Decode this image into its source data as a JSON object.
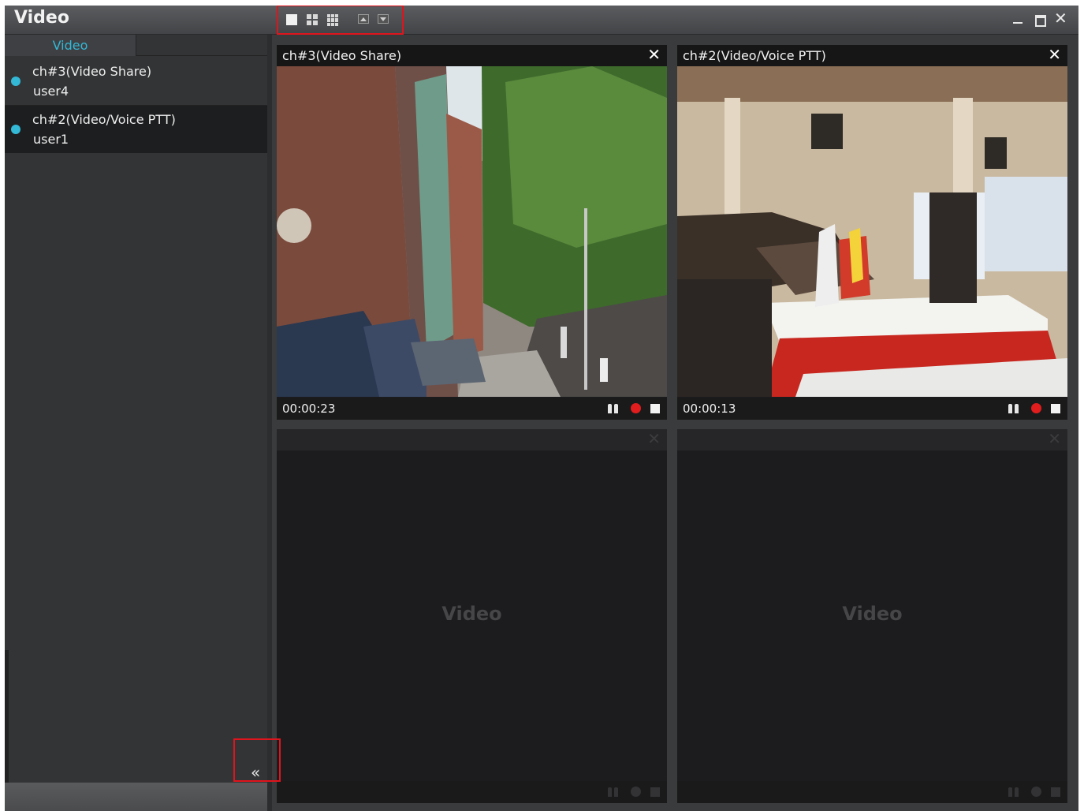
{
  "window": {
    "title": "Video"
  },
  "toolbar": {
    "layout_single": "layout-1x1-icon",
    "layout_quad": "layout-2x2-icon",
    "layout_nine": "layout-3x3-icon",
    "move_up": "move-up-icon",
    "move_down": "move-down-icon"
  },
  "sidebar": {
    "tab_label": "Video",
    "channels": [
      {
        "name": "ch#3(Video Share)",
        "user": "user4"
      },
      {
        "name": "ch#2(Video/Voice PTT)",
        "user": "user1"
      }
    ],
    "collapse_label": "«"
  },
  "panels": [
    {
      "title": "ch#3(Video Share)",
      "time": "00:00:23",
      "close": "✕"
    },
    {
      "title": "ch#2(Video/Voice PTT)",
      "time": "00:00:13",
      "close": "✕"
    },
    {
      "placeholder": "Video",
      "close": "✕"
    },
    {
      "placeholder": "Video",
      "close": "✕"
    }
  ],
  "colors": {
    "accent": "#33b8d6",
    "record": "#e11d1d",
    "highlight": "#e0141c"
  }
}
